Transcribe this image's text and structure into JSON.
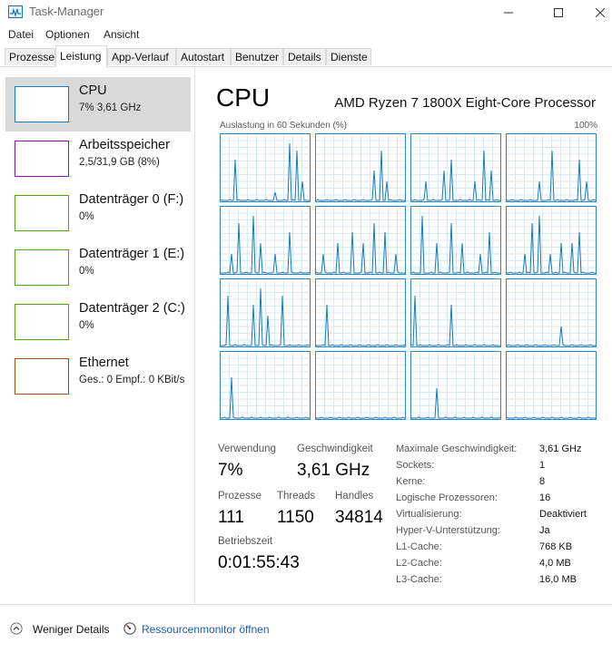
{
  "window": {
    "title": "Task-Manager"
  },
  "menu": [
    "Datei",
    "Optionen",
    "Ansicht"
  ],
  "tabs": [
    "Prozesse",
    "Leistung",
    "App-Verlauf",
    "Autostart",
    "Benutzer",
    "Details",
    "Dienste"
  ],
  "active_tab": "Leistung",
  "sidebar": {
    "items": [
      {
        "title": "CPU",
        "sub": "7% 3,61 GHz",
        "color": "#117dbb",
        "selected": true
      },
      {
        "title": "Arbeitsspeicher",
        "sub": "2,5/31,9 GB (8%)",
        "color": "#8b12ae",
        "selected": false
      },
      {
        "title": "Datenträger 0 (F:)",
        "sub": "0%",
        "color": "#4da60c",
        "selected": false
      },
      {
        "title": "Datenträger 1 (E:)",
        "sub": "0%",
        "color": "#4da60c",
        "selected": false
      },
      {
        "title": "Datenträger 2 (C:)",
        "sub": "0%",
        "color": "#4da60c",
        "selected": false
      },
      {
        "title": "Ethernet",
        "sub": "Ges.: 0 Empf.: 0 KBit/s",
        "color": "#a74f01",
        "selected": false
      }
    ]
  },
  "main": {
    "title": "CPU",
    "processor": "AMD Ryzen 7 1800X Eight-Core Processor",
    "graph_label": "Auslastung in 60 Sekunden (%)",
    "graph_max": "100%",
    "graph_color": "#117dbb",
    "stats": {
      "usage_label": "Verwendung",
      "usage": "7%",
      "speed_label": "Geschwindigkeit",
      "speed": "3,61 GHz",
      "processes_label": "Prozesse",
      "processes": "111",
      "threads_label": "Threads",
      "threads": "1150",
      "handles_label": "Handles",
      "handles": "34814",
      "uptime_label": "Betriebszeit",
      "uptime": "0:01:55:43"
    },
    "specs": [
      {
        "label": "Maximale Geschwindigkeit:",
        "value": "3,61 GHz"
      },
      {
        "label": "Sockets:",
        "value": "1"
      },
      {
        "label": "Kerne:",
        "value": "8"
      },
      {
        "label": "Logische Prozessoren:",
        "value": "16"
      },
      {
        "label": "Virtualisierung:",
        "value": "Deaktiviert"
      },
      {
        "label": "Hyper-V-Unterstützung:",
        "value": "Ja"
      },
      {
        "label": "L1-Cache:",
        "value": "768 KB"
      },
      {
        "label": "L2-Cache:",
        "value": "4,0 MB"
      },
      {
        "label": "L3-Cache:",
        "value": "16,0 MB"
      }
    ]
  },
  "footer": {
    "fewer_details": "Weniger Details",
    "resource_monitor": "Ressourcenmonitor öffnen"
  },
  "icons": {
    "collapse": "chevron-up-icon",
    "resource_monitor": "resource-monitor-icon"
  }
}
